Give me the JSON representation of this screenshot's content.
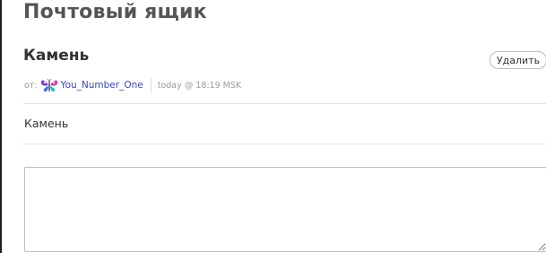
{
  "page": {
    "title": "Почтовый ящик"
  },
  "message": {
    "subject": "Камень",
    "from_label": "от:",
    "sender": {
      "name": "You_Number_One",
      "avatar_icon": "butterfly-avatar-icon"
    },
    "timestamp": "today @ 18:19 MSK",
    "body": "Камень"
  },
  "actions": {
    "delete_label": "Удалить"
  },
  "reply": {
    "value": "",
    "placeholder": ""
  },
  "colors": {
    "sender_link": "#3b48b0",
    "muted_text": "#9a9a9a",
    "title": "#555555",
    "divider": "#e3e3e3"
  }
}
